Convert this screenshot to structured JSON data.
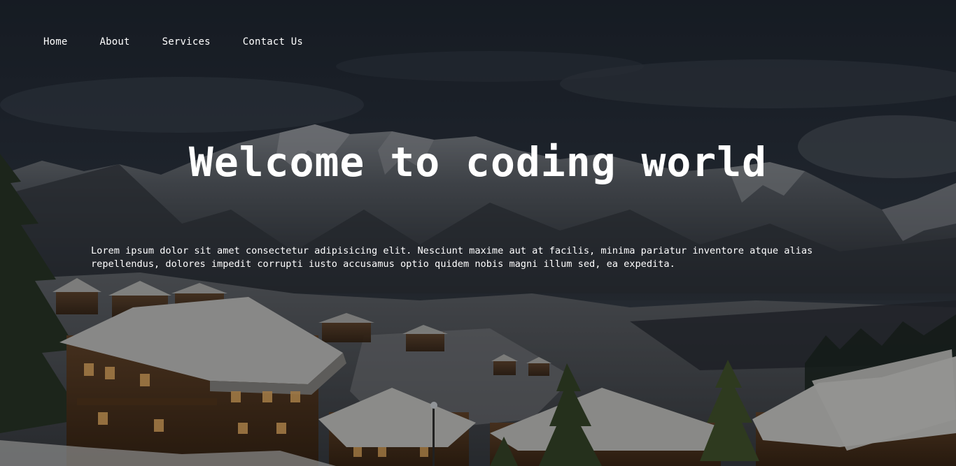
{
  "nav": {
    "items": [
      {
        "label": "Home"
      },
      {
        "label": "About"
      },
      {
        "label": "Services"
      },
      {
        "label": "Contact Us"
      }
    ]
  },
  "hero": {
    "title": "Welcome to coding world",
    "paragraph": "Lorem ipsum dolor sit amet consectetur adipisicing elit. Nesciunt maxime aut at facilis, minima pariatur inventore atque alias repellendus, dolores impedit corrupti iusto accusamus optio quidem nobis magni illum sed, ea expedita."
  },
  "colors": {
    "text": "#ffffff",
    "sky": "#26303d",
    "overlay": "#000000"
  }
}
